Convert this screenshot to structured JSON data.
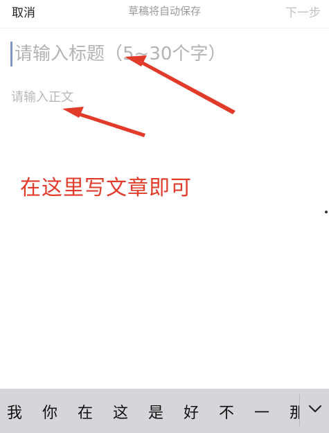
{
  "topbar": {
    "cancel_label": "取消",
    "status_text": "草稿将自动保存",
    "next_label": "下一步"
  },
  "editor": {
    "title_placeholder": "请输入标题（5~30个字）",
    "body_placeholder": "请输入正文"
  },
  "annotation": {
    "text": "在这里写文章即可",
    "color": "#e23b2a"
  },
  "candidates": {
    "items": [
      "我",
      "你",
      "在",
      "这",
      "是",
      "好",
      "不",
      "一",
      "那"
    ],
    "expand_icon": "chevron-down-icon"
  }
}
